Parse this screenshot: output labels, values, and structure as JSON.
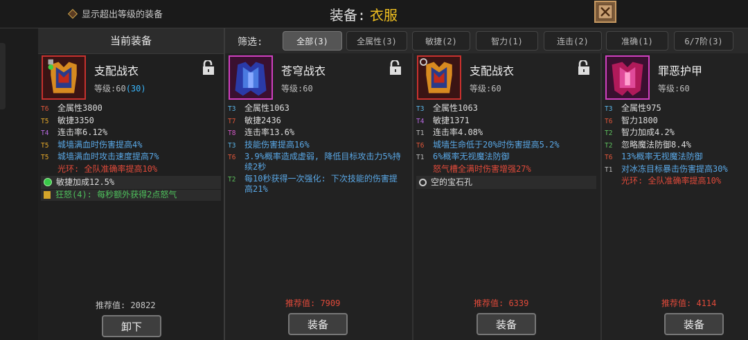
{
  "header": {
    "show_over_level": "显示超出等级的装备",
    "title_label": "装备:",
    "title_value": "衣服"
  },
  "current_panel": {
    "header": "当前装备",
    "item": {
      "name": "支配战衣",
      "level_label": "等级:60",
      "level_bonus": "(30)",
      "stats": [
        {
          "tier": "T6",
          "text": "全属性3800",
          "color": "white"
        },
        {
          "tier": "T5",
          "text": "敏捷3350",
          "color": "white"
        },
        {
          "tier": "T4",
          "text": "连击率6.12%",
          "color": "white"
        },
        {
          "tier": "T5",
          "text": "城墙满血时伤害提高4%",
          "color": "blue"
        },
        {
          "tier": "T5",
          "text": "城墙满血时攻击速度提高7%",
          "color": "blue"
        },
        {
          "tier": "",
          "text": "光环: 全队准确率提高10%",
          "color": "red"
        }
      ],
      "gem_text": "敏捷加成12.5%",
      "set_text": "狂怒(4): 每秒额外获得2点怒气",
      "recommend": "推荐值: 20822",
      "action": "卸下"
    }
  },
  "filter": {
    "label": "筛选:",
    "buttons": [
      "全部(3)",
      "全属性(3)",
      "敏捷(2)",
      "智力(1)",
      "连击(2)",
      "准确(1)",
      "6/7阶(3)"
    ],
    "active_index": 0
  },
  "candidates": [
    {
      "name": "苍穹战衣",
      "level_label": "等级:60",
      "stats": [
        {
          "tier": "T3",
          "text": "全属性1063",
          "color": "white"
        },
        {
          "tier": "T7",
          "text": "敏捷2436",
          "color": "white"
        },
        {
          "tier": "T8",
          "text": "连击率13.6%",
          "color": "white"
        },
        {
          "tier": "T3",
          "text": "技能伤害提高16%",
          "color": "blue"
        },
        {
          "tier": "T6",
          "text": "3.9%概率造成虚弱, 降低目标攻击力5%持续2秒",
          "color": "blue"
        },
        {
          "tier": "T2",
          "text": "每10秒获得一次强化: 下次技能的伤害提高21%",
          "color": "blue"
        }
      ],
      "recommend": "推荐值: 7909",
      "action": "装备"
    },
    {
      "name": "支配战衣",
      "level_label": "等级:60",
      "stats": [
        {
          "tier": "T3",
          "text": "全属性1063",
          "color": "white"
        },
        {
          "tier": "T4",
          "text": "敏捷1371",
          "color": "white"
        },
        {
          "tier": "T1",
          "text": "连击率4.08%",
          "color": "white"
        },
        {
          "tier": "T6",
          "text": "城墙生命低于20%时伤害提高5.2%",
          "color": "blue"
        },
        {
          "tier": "T1",
          "text": "6%概率无视魔法防御",
          "color": "blue"
        },
        {
          "tier": "",
          "text": "怒气槽全满时伤害增强27%",
          "color": "red"
        }
      ],
      "socket_text": "空的宝石孔",
      "recommend": "推荐值: 6339",
      "action": "装备"
    },
    {
      "name": "罪恶护甲",
      "level_label": "等级:60",
      "stats": [
        {
          "tier": "T3",
          "text": "全属性975",
          "color": "white"
        },
        {
          "tier": "T6",
          "text": "智力1800",
          "color": "white"
        },
        {
          "tier": "T2",
          "text": "智力加成4.2%",
          "color": "white"
        },
        {
          "tier": "T2",
          "text": "忽略魔法防御8.4%",
          "color": "white"
        },
        {
          "tier": "T6",
          "text": "13%概率无视魔法防御",
          "color": "blue"
        },
        {
          "tier": "T1",
          "text": "对冰冻目标暴击伤害提高30%",
          "color": "blue"
        },
        {
          "tier": "",
          "text": "光环: 全队准确率提高10%",
          "color": "red"
        }
      ],
      "recommend": "推荐值: 4114",
      "action": "装备"
    }
  ],
  "icons": {
    "close": "close-x-icon",
    "lock": "unlock-padlock-icon",
    "gem": "green-gem-icon",
    "set": "set-book-icon"
  },
  "colors": {
    "tier_T6": "#e0563a",
    "tier_T5": "#e3a72a",
    "tier_T4": "#b96ae2",
    "tier_T3": "#5ab4e6",
    "tier_T2": "#5ec05e",
    "tier_T1": "#bbbbbb",
    "tier_T7": "#e0563a",
    "tier_T8": "#d458c8",
    "title_value": "#f0c020",
    "recommend_red": "#e04a3a"
  }
}
